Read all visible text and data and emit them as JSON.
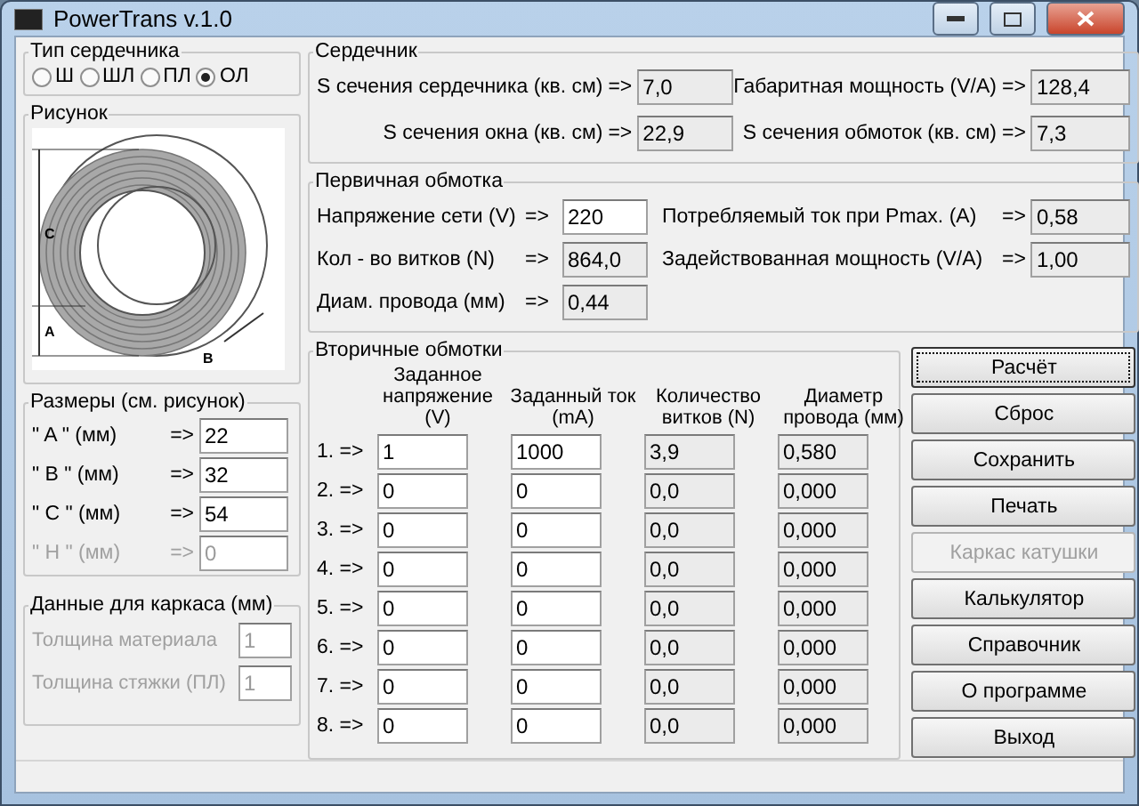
{
  "window": {
    "title": "PowerTrans v.1.0"
  },
  "core_type": {
    "label": "Тип сердечника",
    "options": [
      {
        "label": "Ш",
        "selected": false
      },
      {
        "label": "ШЛ",
        "selected": false
      },
      {
        "label": "ПЛ",
        "selected": false
      },
      {
        "label": "ОЛ",
        "selected": true
      }
    ]
  },
  "figure": {
    "label": "Рисунок",
    "dim_c": "C",
    "dim_a": "A",
    "dim_b": "B"
  },
  "dimensions": {
    "label": "Размеры (см. рисунок)",
    "rows": [
      {
        "label": "\" A \"  (мм)",
        "arrow": "=>",
        "value": "22",
        "disabled": false
      },
      {
        "label": "\" B \"  (мм)",
        "arrow": "=>",
        "value": "32",
        "disabled": false
      },
      {
        "label": "\" C \"  (мм)",
        "arrow": "=>",
        "value": "54",
        "disabled": false
      },
      {
        "label": "\" H \"  (мм)",
        "arrow": "=>",
        "value": "0",
        "disabled": true
      }
    ]
  },
  "frame_data": {
    "label": "Данные для каркаса (мм)",
    "rows": [
      {
        "label": "Толщина материала",
        "value": "1",
        "disabled": true
      },
      {
        "label": "Толщина стяжки (ПЛ)",
        "value": "1",
        "disabled": true
      }
    ]
  },
  "core": {
    "label": "Сердечник",
    "fields": [
      {
        "label": "S сечения сердечника (кв. см)",
        "arrow": "=>",
        "value": "7,0",
        "readonly": true
      },
      {
        "label": "Габаритная мощность (V/A)",
        "arrow": "=>",
        "value": "128,4",
        "readonly": true
      },
      {
        "label": "S сечения окна (кв. см)",
        "arrow": "=>",
        "value": "22,9",
        "readonly": true
      },
      {
        "label": "S сечения обмоток (кв. см)",
        "arrow": "=>",
        "value": "7,3",
        "readonly": true
      }
    ]
  },
  "primary": {
    "label": "Первичная обмотка",
    "left": [
      {
        "label": "Напряжение сети (V)",
        "arrow": "=>",
        "value": "220",
        "readonly": false
      },
      {
        "label": "Кол - во витков (N)",
        "arrow": "=>",
        "value": "864,0",
        "readonly": true
      },
      {
        "label": "Диам. провода (мм)",
        "arrow": "=>",
        "value": "0,44",
        "readonly": true
      }
    ],
    "right": [
      {
        "label": "Потребляемый ток при Pmax. (A)",
        "arrow": "=>",
        "value": "0,58",
        "readonly": true
      },
      {
        "label": "Задействованная мощность (V/A)",
        "arrow": "=>",
        "value": "1,00",
        "readonly": true
      }
    ]
  },
  "secondary": {
    "label": "Вторичные обмотки",
    "columns": [
      "Заданное напряжение (V)",
      "Заданный ток (mA)",
      "Количество витков (N)",
      "Диаметр провода (мм)"
    ],
    "rows": [
      {
        "index": "1. =>",
        "voltage": "1",
        "current": "1000",
        "turns": "3,9",
        "diameter": "0,580"
      },
      {
        "index": "2. =>",
        "voltage": "0",
        "current": "0",
        "turns": "0,0",
        "diameter": "0,000"
      },
      {
        "index": "3. =>",
        "voltage": "0",
        "current": "0",
        "turns": "0,0",
        "diameter": "0,000"
      },
      {
        "index": "4. =>",
        "voltage": "0",
        "current": "0",
        "turns": "0,0",
        "diameter": "0,000"
      },
      {
        "index": "5. =>",
        "voltage": "0",
        "current": "0",
        "turns": "0,0",
        "diameter": "0,000"
      },
      {
        "index": "6. =>",
        "voltage": "0",
        "current": "0",
        "turns": "0,0",
        "diameter": "0,000"
      },
      {
        "index": "7. =>",
        "voltage": "0",
        "current": "0",
        "turns": "0,0",
        "diameter": "0,000"
      },
      {
        "index": "8. =>",
        "voltage": "0",
        "current": "0",
        "turns": "0,0",
        "diameter": "0,000"
      }
    ]
  },
  "buttons": [
    {
      "label": "Расчёт",
      "focused": true,
      "disabled": false
    },
    {
      "label": "Сброс",
      "focused": false,
      "disabled": false
    },
    {
      "label": "Сохранить",
      "focused": false,
      "disabled": false
    },
    {
      "label": "Печать",
      "focused": false,
      "disabled": false
    },
    {
      "label": "Каркас катушки",
      "focused": false,
      "disabled": true
    },
    {
      "label": "Калькулятор",
      "focused": false,
      "disabled": false
    },
    {
      "label": "Справочник",
      "focused": false,
      "disabled": false
    },
    {
      "label": "О программе",
      "focused": false,
      "disabled": false
    },
    {
      "label": "Выход",
      "focused": false,
      "disabled": false
    }
  ]
}
